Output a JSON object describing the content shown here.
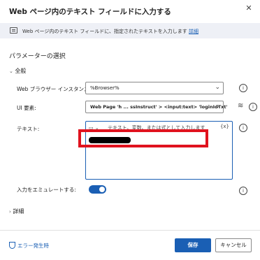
{
  "dialog": {
    "title": "Web ページ内のテキスト フィールドに入力する",
    "close_glyph": "✕"
  },
  "banner": {
    "text": "Web ページ内のテキスト フィールドに、指定されたテキストを入力します",
    "link": "詳細",
    "icon": "text-field-icon"
  },
  "params": {
    "section_title": "パラメーターの選択",
    "group_general": "全般",
    "browser_label": "Web ブラウザー インスタンス:",
    "browser_value": "%Browser%",
    "ui_label": "UI 要素:",
    "ui_value": "Web Page 'h ... ssInstruct' > <input:text> 'loginIdTxt'",
    "text_label": "テキスト:",
    "text_toolbar": "テキスト、変数、または式として入力します",
    "text_var_btn": "{x}",
    "emulate_label": "入力をエミュレートする:",
    "emulate_on": true,
    "group_details": "詳細"
  },
  "footer": {
    "error_link": "エラー発生時",
    "save": "保存",
    "cancel": "キャンセル"
  },
  "colors": {
    "accent": "#1a5fb4",
    "highlight": "#e0121e"
  }
}
